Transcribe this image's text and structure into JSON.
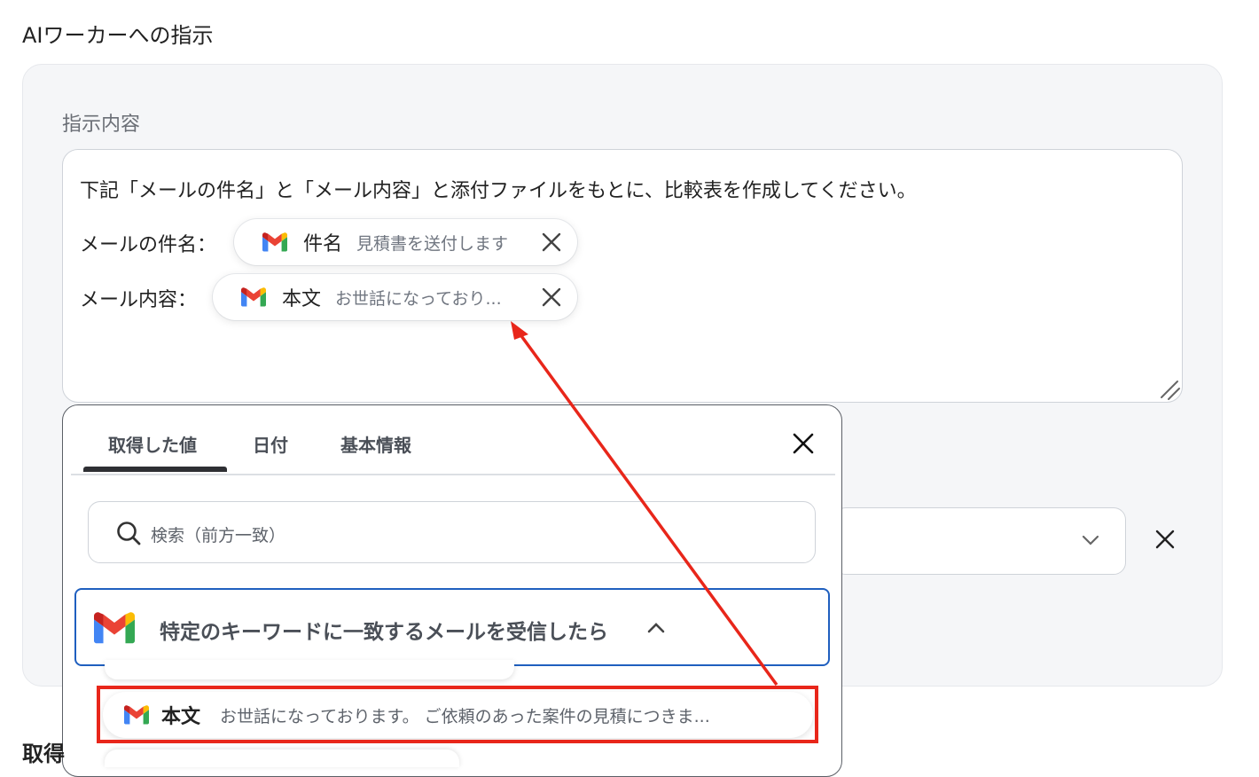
{
  "section_title": "AIワーカーへの指示",
  "field_label": "指示内容",
  "instruction_text": "下記「メールの件名」と「メール内容」と添付ファイルをもとに、比較表を作成してください。",
  "subject_label": "メールの件名：",
  "body_label": "メール内容：",
  "chips": [
    {
      "title": "件名",
      "value": "見積書を送付します",
      "icon": "gmail-icon"
    },
    {
      "title": "本文",
      "value": "お世話になっており...",
      "icon": "gmail-icon"
    }
  ],
  "popup": {
    "tabs": [
      "取得した値",
      "日付",
      "基本情報"
    ],
    "active_tab": "取得した値",
    "search_placeholder": "検索（前方一致）",
    "trigger_label": "特定のキーワードに一致するメールを受信したら",
    "result": {
      "title": "本文",
      "value": "お世話になっております。 ご依頼のあった案件の見積につきま..."
    }
  },
  "cut_text": "取得",
  "colors": {
    "highlight": "#e8261a",
    "trigger_border": "#1f5fbf"
  }
}
